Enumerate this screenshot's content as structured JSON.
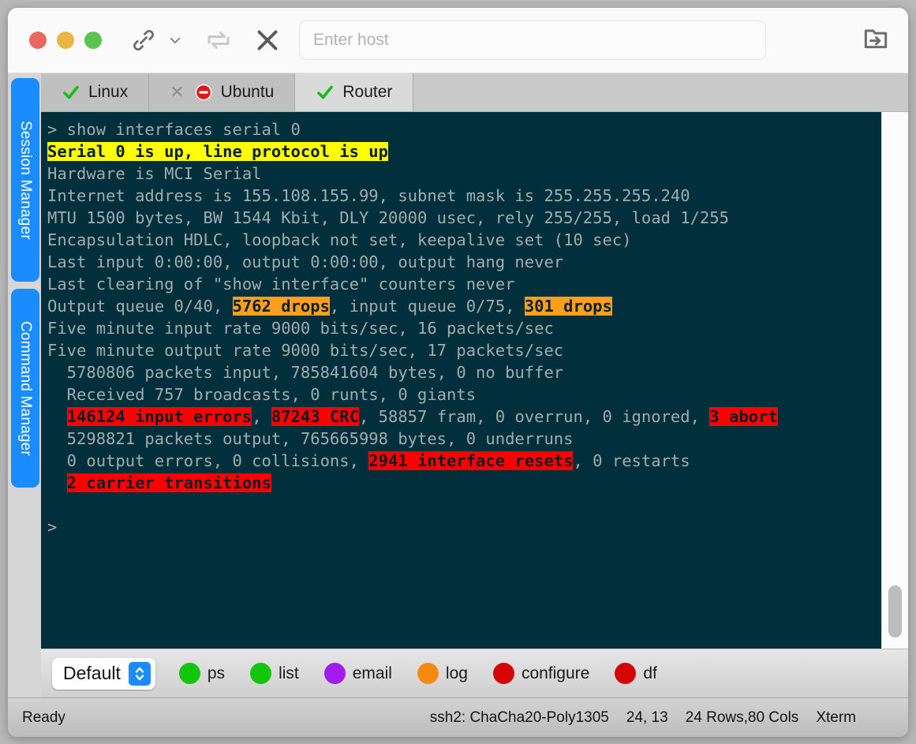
{
  "titlebar": {
    "traffic_lights": [
      "close",
      "minimize",
      "zoom"
    ],
    "link_icon": "chain-link-icon",
    "dropdown_icon": "chevron-down-icon",
    "reconnect_icon": "loop-repeat-icon",
    "disconnect_icon": "close-x-icon",
    "open_folder_icon": "folder-import-icon",
    "host": {
      "placeholder": "Enter host",
      "value": ""
    }
  },
  "side_tabs": [
    {
      "label": "Session Manager",
      "name": "session-manager"
    },
    {
      "label": "Command Manager",
      "name": "command-manager"
    }
  ],
  "tabs": [
    {
      "label": "Linux",
      "status_icon": "green-check",
      "active": false,
      "closable": false
    },
    {
      "label": "Ubuntu",
      "status_icon": "red-no-entry",
      "active": false,
      "closable": true
    },
    {
      "label": "Router",
      "status_icon": "green-check",
      "active": true,
      "closable": false
    }
  ],
  "terminal": {
    "prompt": ">",
    "command": "show interfaces serial 0",
    "lines": [
      [
        {
          "t": "> show interfaces serial 0"
        }
      ],
      [
        {
          "t": "Serial 0 is up, line protocol is up",
          "hl": "yellow"
        }
      ],
      [
        {
          "t": "Hardware is MCI Serial"
        }
      ],
      [
        {
          "t": "Internet address is 155.108.155.99, subnet mask is 255.255.255.240"
        }
      ],
      [
        {
          "t": "MTU 1500 bytes, BW 1544 Kbit, DLY 20000 usec, rely 255/255, load 1/255"
        }
      ],
      [
        {
          "t": "Encapsulation HDLC, loopback not set, keepalive set (10 sec)"
        }
      ],
      [
        {
          "t": "Last input 0:00:00, output 0:00:00, output hang never"
        }
      ],
      [
        {
          "t": "Last clearing of \"show interface\" counters never"
        }
      ],
      [
        {
          "t": "Output queue 0/40, "
        },
        {
          "t": "5762 drops",
          "hl": "orange"
        },
        {
          "t": ", input queue 0/75, "
        },
        {
          "t": "301 drops",
          "hl": "orange"
        }
      ],
      [
        {
          "t": "Five minute input rate 9000 bits/sec, 16 packets/sec"
        }
      ],
      [
        {
          "t": "Five minute output rate 9000 bits/sec, 17 packets/sec"
        }
      ],
      [
        {
          "t": "  5780806 packets input, 785841604 bytes, 0 no buffer"
        }
      ],
      [
        {
          "t": "  Received 757 broadcasts, 0 runts, 0 giants"
        }
      ],
      [
        {
          "t": "  "
        },
        {
          "t": "146124 input errors",
          "hl": "red"
        },
        {
          "t": ", "
        },
        {
          "t": "87243 CRC",
          "hl": "red"
        },
        {
          "t": ", 58857 fram, 0 overrun, 0 ignored, "
        },
        {
          "t": "3 abort",
          "hl": "red"
        }
      ],
      [
        {
          "t": "  5298821 packets output, 765665998 bytes, 0 underruns"
        }
      ],
      [
        {
          "t": "  0 output errors, 0 collisions, "
        },
        {
          "t": "2941 interface resets",
          "hl": "red"
        },
        {
          "t": ", 0 restarts"
        }
      ],
      [
        {
          "t": "  "
        },
        {
          "t": "2 carrier transitions",
          "hl": "red"
        }
      ],
      [
        {
          "t": ""
        }
      ],
      [
        {
          "t": ">"
        }
      ]
    ],
    "colors": {
      "background": "#01303c",
      "foreground": "#9fadb0",
      "highlight_yellow": "#ffff00",
      "highlight_orange": "#ff9f1c",
      "highlight_red": "#ff0000"
    }
  },
  "buttonbar": {
    "profile_select": {
      "label": "Default"
    },
    "commands": [
      {
        "label": "ps",
        "color": "#11c60b"
      },
      {
        "label": "list",
        "color": "#11c60b"
      },
      {
        "label": "email",
        "color": "#a21cf0"
      },
      {
        "label": "log",
        "color": "#f58a10"
      },
      {
        "label": "configure",
        "color": "#d60505"
      },
      {
        "label": "df",
        "color": "#d60505"
      }
    ]
  },
  "statusbar": {
    "state": "Ready",
    "cipher": "ssh2: ChaCha20-Poly1305",
    "cursor": "24, 13",
    "geometry": "24 Rows,80 Cols",
    "emulation": "Xterm"
  }
}
